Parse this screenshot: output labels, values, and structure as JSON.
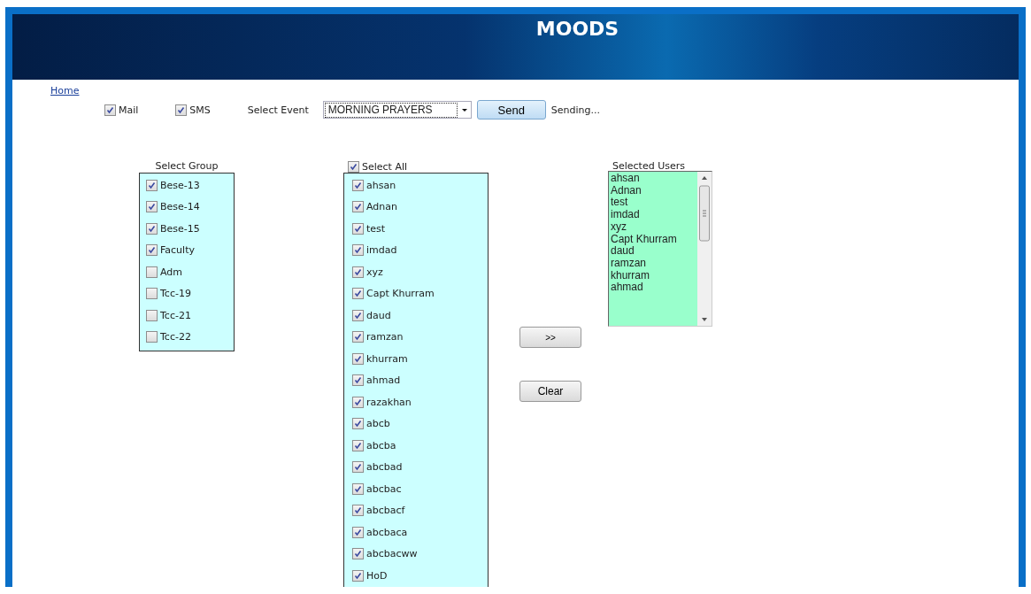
{
  "header": {
    "title": "MOODS"
  },
  "home_link": "Home",
  "options": [
    {
      "kind": "checkbox",
      "label": "Mail",
      "checked": true
    },
    {
      "kind": "checkbox",
      "label": "SMS",
      "checked": true
    },
    {
      "kind": "label",
      "label": "Select Event"
    },
    {
      "kind": "dropdown",
      "value": "MORNING PRAYERS"
    },
    {
      "kind": "button",
      "label": "Send"
    },
    {
      "kind": "status",
      "label": "Sending..."
    }
  ],
  "groups": {
    "title": "Select Group",
    "items": [
      {
        "label": "Bese-13",
        "checked": true
      },
      {
        "label": "Bese-14",
        "checked": true
      },
      {
        "label": "Bese-15",
        "checked": true
      },
      {
        "label": "Faculty",
        "checked": true
      },
      {
        "label": "Adm",
        "checked": false
      },
      {
        "label": "Tcc-19",
        "checked": false
      },
      {
        "label": "Tcc-21",
        "checked": false
      },
      {
        "label": "Tcc-22",
        "checked": false
      }
    ]
  },
  "users": {
    "select_all": {
      "label": "Select All",
      "checked": true
    },
    "items": [
      {
        "label": "ahsan",
        "checked": true
      },
      {
        "label": "Adnan",
        "checked": true
      },
      {
        "label": "test",
        "checked": true
      },
      {
        "label": "imdad",
        "checked": true
      },
      {
        "label": "xyz",
        "checked": true
      },
      {
        "label": "Capt Khurram",
        "checked": true
      },
      {
        "label": "daud",
        "checked": true
      },
      {
        "label": "ramzan",
        "checked": true
      },
      {
        "label": "khurram",
        "checked": true
      },
      {
        "label": "ahmad",
        "checked": true
      },
      {
        "label": "razakhan",
        "checked": true
      },
      {
        "label": "abcb",
        "checked": true
      },
      {
        "label": "abcba",
        "checked": true
      },
      {
        "label": "abcbad",
        "checked": true
      },
      {
        "label": "abcbac",
        "checked": true
      },
      {
        "label": "abcbacf",
        "checked": true
      },
      {
        "label": "abcbaca",
        "checked": true
      },
      {
        "label": "abcbacww",
        "checked": true
      },
      {
        "label": "HoD",
        "checked": true
      }
    ]
  },
  "actions": [
    {
      "label": ">>"
    },
    {
      "label": "Clear"
    }
  ],
  "selected_users": {
    "title": "Selected Users",
    "items": [
      "ahsan",
      "Adnan",
      "test",
      "imdad",
      "xyz",
      "Capt Khurram",
      "daud",
      "ramzan",
      "khurram",
      "ahmad"
    ]
  }
}
